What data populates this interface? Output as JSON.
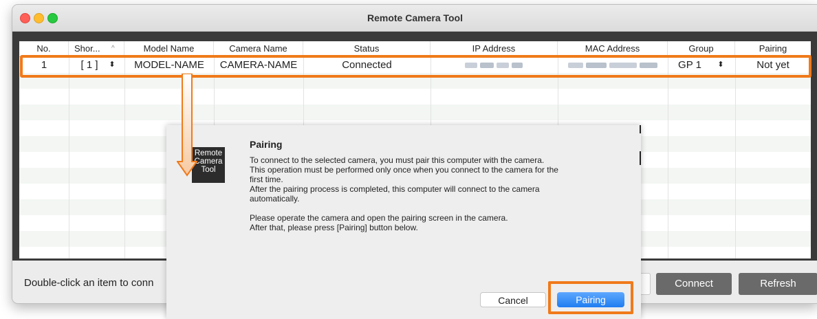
{
  "window": {
    "title": "Remote Camera Tool"
  },
  "table": {
    "columns": [
      "No.",
      "Shor...",
      "Model Name",
      "Camera Name",
      "Status",
      "IP Address",
      "MAC Address",
      "Group",
      "Pairing"
    ],
    "sort_indicator": "^",
    "rows": [
      {
        "no": "1",
        "short": "[ 1 ]",
        "model": "MODEL-NAME",
        "camera": "CAMERA-NAME",
        "status": "Connected",
        "ip": "",
        "mac": "",
        "group": "GP 1",
        "pairing": "Not yet"
      }
    ]
  },
  "bottom": {
    "hint": "Double-click an item to conn",
    "connect_label": "Connect",
    "refresh_label": "Refresh"
  },
  "dialog": {
    "icon_text": [
      "Remote",
      "Camera",
      "Tool"
    ],
    "title": "Pairing",
    "lines": [
      "To connect to the selected camera, you must pair this computer with the camera.",
      "This operation must be performed only once when you connect to the camera for the",
      "first time.",
      "After the pairing process is completed, this computer will connect to the camera",
      "automatically.",
      "",
      "Please operate the camera and open the pairing screen in the camera.",
      "After that, please press [Pairing] button below."
    ],
    "cancel_label": "Cancel",
    "pairing_label": "Pairing"
  },
  "colors": {
    "highlight": "#f07a1a",
    "primary_button": "#1f7df0",
    "dark_button": "#6a6a6a"
  }
}
